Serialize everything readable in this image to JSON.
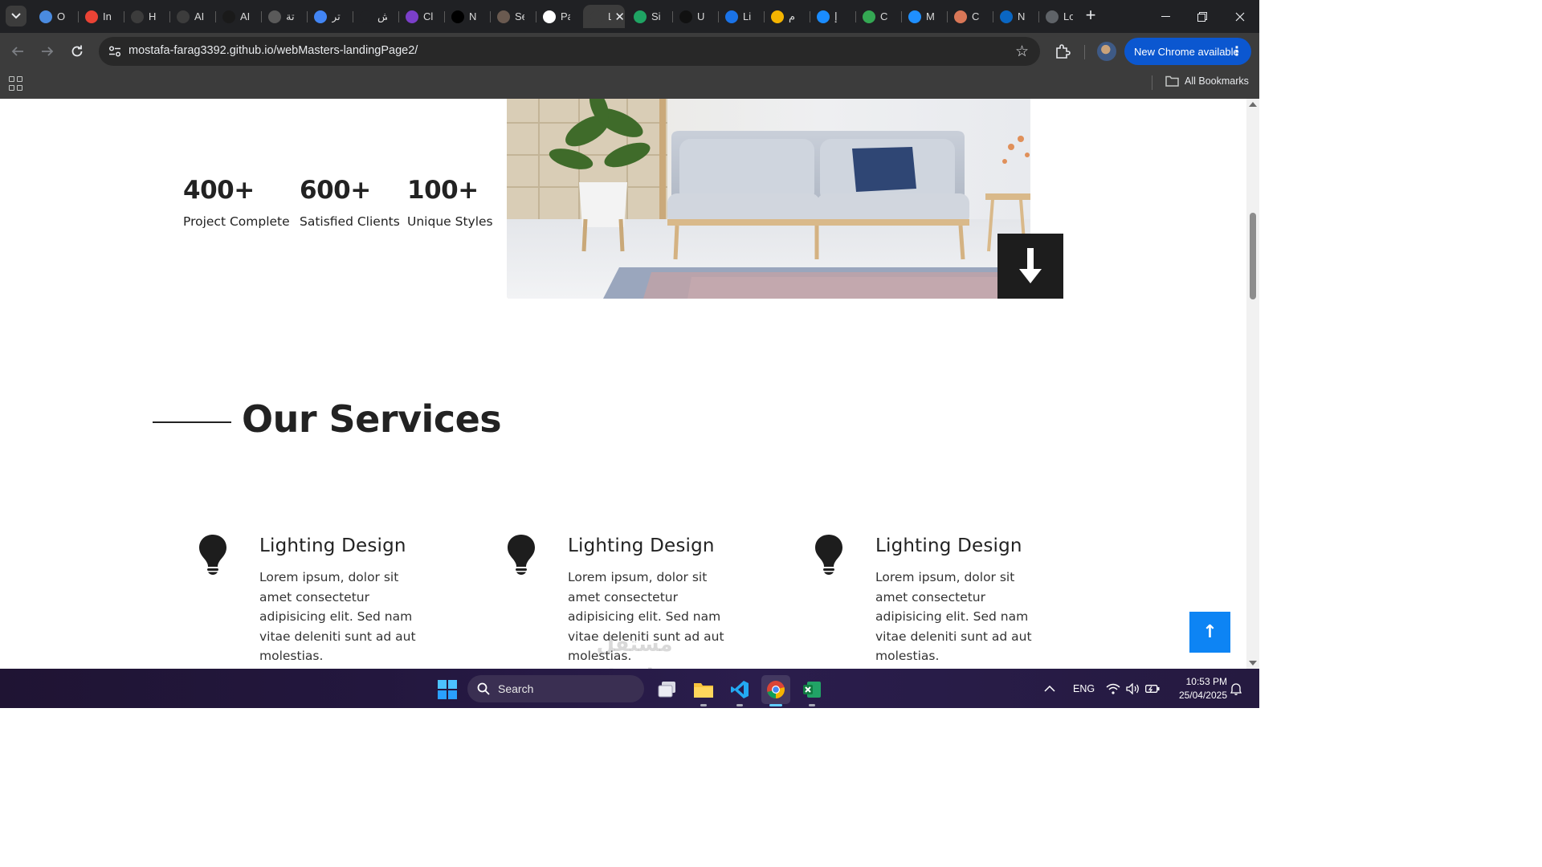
{
  "browser": {
    "tabs": [
      {
        "title": "O",
        "icon": "copilot-icon",
        "color": "#4a8be0"
      },
      {
        "title": "In",
        "icon": "gmail-icon",
        "color": "#ea4335"
      },
      {
        "title": "H",
        "icon": "generic-icon",
        "color": "#3c3c3c"
      },
      {
        "title": "AI",
        "icon": "generic-icon",
        "color": "#3c3c3c"
      },
      {
        "title": "AI",
        "icon": "generic-icon",
        "color": "#1a1a1a"
      },
      {
        "title": "تة",
        "icon": "openai-icon",
        "color": "#5a5a5a"
      },
      {
        "title": "تر",
        "icon": "translate-icon",
        "color": "#4285f4"
      },
      {
        "title": "ش",
        "icon": "loading-icon",
        "color": "#202124"
      },
      {
        "title": "Cl",
        "icon": "generic-icon",
        "color": "#7b3fc9"
      },
      {
        "title": "N",
        "icon": "generic-icon",
        "color": "#000000"
      },
      {
        "title": "Se",
        "icon": "avatar-icon",
        "color": "#6a5a50"
      },
      {
        "title": "Pa",
        "icon": "github-icon",
        "color": "#ffffff"
      },
      {
        "title": "La",
        "icon": "page-icon",
        "color": "#3c3c3c",
        "active": true
      },
      {
        "title": "Si",
        "icon": "generic-icon",
        "color": "#1fa463"
      },
      {
        "title": "U",
        "icon": "upwork-icon",
        "color": "#111111"
      },
      {
        "title": "Li",
        "icon": "generic-icon",
        "color": "#1a73e8"
      },
      {
        "title": "م",
        "icon": "generic-icon",
        "color": "#f4b400"
      },
      {
        "title": "إ",
        "icon": "generic-icon",
        "color": "#1a8cff"
      },
      {
        "title": "C",
        "icon": "drive-icon",
        "color": "#34a853"
      },
      {
        "title": "M",
        "icon": "generic-icon",
        "color": "#1f8fff"
      },
      {
        "title": "C",
        "icon": "claude-icon",
        "color": "#d97757"
      },
      {
        "title": "N",
        "icon": "linkedin-icon",
        "color": "#0a66c2"
      },
      {
        "title": "Lo",
        "icon": "globe-icon",
        "color": "#5f6368"
      }
    ],
    "url": "mostafa-farag3392.github.io/webMasters-landingPage2/",
    "update_label": "New Chrome available",
    "bookmarks_label": "All Bookmarks"
  },
  "page": {
    "stats": [
      {
        "number": "400+",
        "label": "Project Complete"
      },
      {
        "number": "600+",
        "label": "Satisfied Clients"
      },
      {
        "number": "100+",
        "label": "Unique Styles"
      }
    ],
    "services_title": "Our Services",
    "services": [
      {
        "title": "Lighting Design",
        "text": "Lorem ipsum, dolor sit amet consectetur adipisicing elit. Sed nam vitae deleniti sunt ad aut molestias."
      },
      {
        "title": "Lighting Design",
        "text": "Lorem ipsum, dolor sit amet consectetur adipisicing elit. Sed nam vitae deleniti sunt ad aut molestias."
      },
      {
        "title": "Lighting Design",
        "text": "Lorem ipsum, dolor sit amet consectetur adipisicing elit. Sed nam vitae deleniti sunt ad aut molestias."
      }
    ],
    "to_top_label": "↑",
    "watermark": "مستقل mostaql.com"
  },
  "taskbar": {
    "search_label": "Search",
    "language": "ENG",
    "time": "10:53 PM",
    "date": "25/04/2025"
  }
}
